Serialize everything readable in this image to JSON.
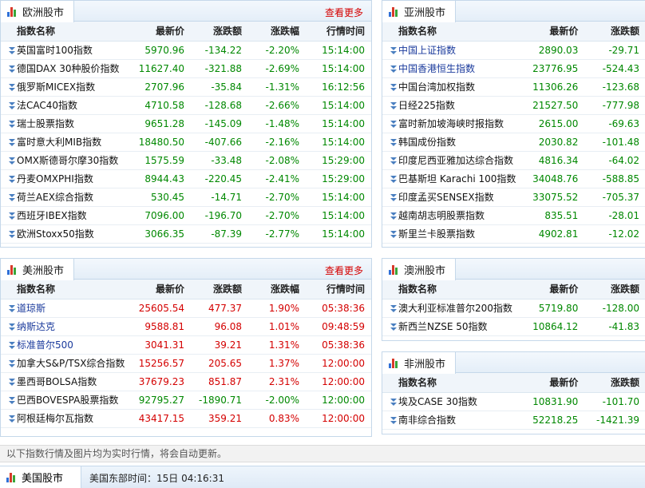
{
  "europe": {
    "title": "欧洲股市",
    "more": "查看更多",
    "headers": [
      "指数名称",
      "最新价",
      "涨跌额",
      "涨跌幅",
      "行情时间"
    ],
    "rows": [
      {
        "name": "英国富时100指数",
        "price": "5970.96",
        "change": "-134.22",
        "pct": "-2.20%",
        "time": "15:14:00"
      },
      {
        "name": "德国DAX 30种股价指数",
        "price": "11627.40",
        "change": "-321.88",
        "pct": "-2.69%",
        "time": "15:14:00"
      },
      {
        "name": "俄罗斯MICEX指数",
        "price": "2707.96",
        "change": "-35.84",
        "pct": "-1.31%",
        "time": "16:12:56"
      },
      {
        "name": "法CAC40指数",
        "price": "4710.58",
        "change": "-128.68",
        "pct": "-2.66%",
        "time": "15:14:00"
      },
      {
        "name": "瑞士股票指数",
        "price": "9651.28",
        "change": "-145.09",
        "pct": "-1.48%",
        "time": "15:14:00"
      },
      {
        "name": "富时意大利MIB指数",
        "price": "18480.50",
        "change": "-407.66",
        "pct": "-2.16%",
        "time": "15:14:00"
      },
      {
        "name": "OMX斯德哥尔摩30指数",
        "price": "1575.59",
        "change": "-33.48",
        "pct": "-2.08%",
        "time": "15:29:00"
      },
      {
        "name": "丹麦OMXPHI指数",
        "price": "8944.43",
        "change": "-220.45",
        "pct": "-2.41%",
        "time": "15:29:00"
      },
      {
        "name": "荷兰AEX综合指数",
        "price": "530.45",
        "change": "-14.71",
        "pct": "-2.70%",
        "time": "15:14:00"
      },
      {
        "name": "西班牙IBEX指数",
        "price": "7096.00",
        "change": "-196.70",
        "pct": "-2.70%",
        "time": "15:14:00"
      },
      {
        "name": "欧洲Stoxx50指数",
        "price": "3066.35",
        "change": "-87.39",
        "pct": "-2.77%",
        "time": "15:14:00"
      }
    ]
  },
  "asia": {
    "title": "亚洲股市",
    "headers": [
      "指数名称",
      "最新价",
      "涨跌额"
    ],
    "rows": [
      {
        "name": "中国上证指数",
        "price": "2890.03",
        "change": "-29.71",
        "link": true
      },
      {
        "name": "中国香港恒生指数",
        "price": "23776.95",
        "change": "-524.43",
        "link": true
      },
      {
        "name": "中国台湾加权指数",
        "price": "11306.26",
        "change": "-123.68"
      },
      {
        "name": "日经225指数",
        "price": "21527.50",
        "change": "-777.98"
      },
      {
        "name": "富时新加坡海峡时报指数",
        "price": "2615.00",
        "change": "-69.63"
      },
      {
        "name": "韩国成份指数",
        "price": "2030.82",
        "change": "-101.48"
      },
      {
        "name": "印度尼西亚雅加达综合指数",
        "price": "4816.34",
        "change": "-64.02"
      },
      {
        "name": "巴基斯坦 Karachi 100指数",
        "price": "34048.76",
        "change": "-588.85"
      },
      {
        "name": "印度孟买SENSEX指数",
        "price": "33075.52",
        "change": "-705.37"
      },
      {
        "name": "越南胡志明股票指数",
        "price": "835.51",
        "change": "-28.01"
      },
      {
        "name": "斯里兰卡股票指数",
        "price": "4902.81",
        "change": "-12.02"
      }
    ]
  },
  "america": {
    "title": "美洲股市",
    "more": "查看更多",
    "headers": [
      "指数名称",
      "最新价",
      "涨跌额",
      "涨跌幅",
      "行情时间"
    ],
    "rows": [
      {
        "name": "道琼斯",
        "price": "25605.54",
        "change": "477.37",
        "pct": "1.90%",
        "time": "05:38:36",
        "link": true,
        "dir": "up",
        "timeup": true
      },
      {
        "name": "纳斯达克",
        "price": "9588.81",
        "change": "96.08",
        "pct": "1.01%",
        "time": "09:48:59",
        "link": true,
        "dir": "up",
        "timeup": true
      },
      {
        "name": "标准普尔500",
        "price": "3041.31",
        "change": "39.21",
        "pct": "1.31%",
        "time": "05:38:36",
        "link": true,
        "dir": "up",
        "timeup": true
      },
      {
        "name": "加拿大S&P/TSX综合指数",
        "price": "15256.57",
        "change": "205.65",
        "pct": "1.37%",
        "time": "12:00:00",
        "dir": "up",
        "timeup": true
      },
      {
        "name": "墨西哥BOLSA指数",
        "price": "37679.23",
        "change": "851.87",
        "pct": "2.31%",
        "time": "12:00:00",
        "dir": "up",
        "timeup": true
      },
      {
        "name": "巴西BOVESPA股票指数",
        "price": "92795.27",
        "change": "-1890.71",
        "pct": "-2.00%",
        "time": "12:00:00",
        "dir": "down",
        "timeup": false
      },
      {
        "name": "阿根廷梅尔瓦指数",
        "price": "43417.15",
        "change": "359.21",
        "pct": "0.83%",
        "time": "12:00:00",
        "dir": "up",
        "timeup": true
      }
    ]
  },
  "oceania": {
    "title": "澳洲股市",
    "headers": [
      "指数名称",
      "最新价",
      "涨跌额"
    ],
    "rows": [
      {
        "name": "澳大利亚标准普尔200指数",
        "price": "5719.80",
        "change": "-128.00"
      },
      {
        "name": "新西兰NZSE 50指数",
        "price": "10864.12",
        "change": "-41.83"
      }
    ]
  },
  "africa": {
    "title": "非洲股市",
    "headers": [
      "指数名称",
      "最新价",
      "涨跌额"
    ],
    "rows": [
      {
        "name": "埃及CASE 30指数",
        "price": "10831.90",
        "change": "-101.70"
      },
      {
        "name": "南非综合指数",
        "price": "52218.25",
        "change": "-1421.39"
      }
    ]
  },
  "footer_note": "以下指数行情及图片均为实时行情，将会自动更新。",
  "bottom": {
    "tab": "美国股市",
    "time": "美国东部时间：15日 04:16:31"
  },
  "colors": {
    "up": "#d40000",
    "down": "#008800",
    "border": "#c5d8ea",
    "link": "#1a3a9c"
  }
}
